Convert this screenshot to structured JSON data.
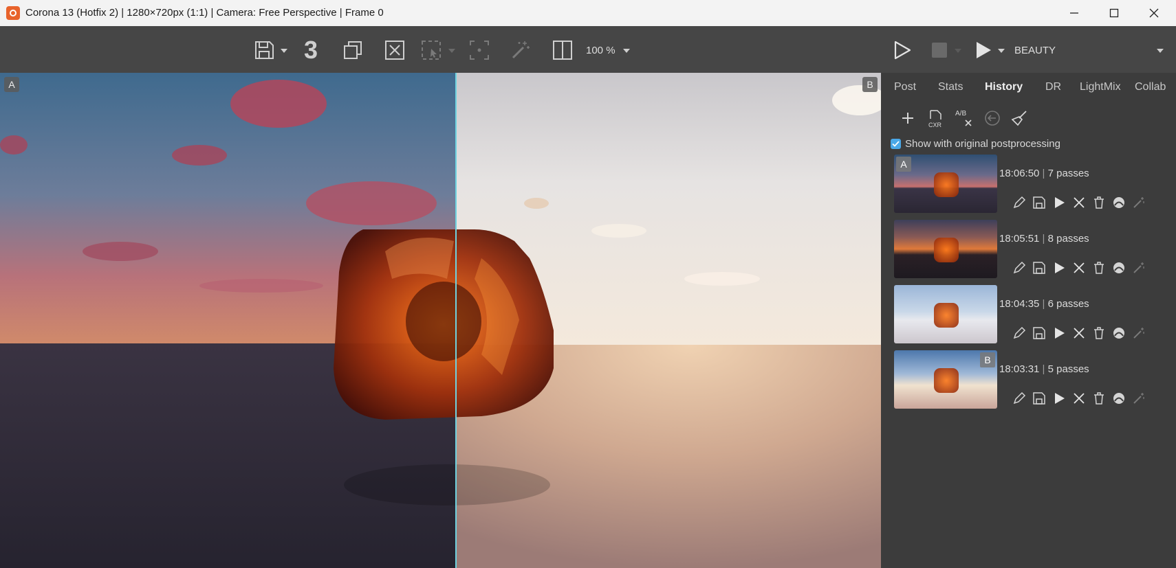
{
  "window": {
    "title": "Corona 13 (Hotfix 2) | 1280×720px (1:1) | Camera: Free Perspective | Frame 0"
  },
  "toolbar": {
    "pass_count": "3",
    "zoom": "100 %",
    "render_element": "BEAUTY"
  },
  "viewport": {
    "label_a": "A",
    "label_b": "B"
  },
  "sidepanel": {
    "tabs": [
      {
        "label": "Post"
      },
      {
        "label": "Stats"
      },
      {
        "label": "History",
        "active": true
      },
      {
        "label": "DR"
      },
      {
        "label": "LightMix"
      },
      {
        "label": "Collab"
      }
    ],
    "toolbar_icons": [
      "plus-icon",
      "save-cxr-icon",
      "ab-clear-icon",
      "revert-icon",
      "broom-icon"
    ],
    "show_original": {
      "label": "Show with original postprocessing",
      "checked": true
    },
    "history": [
      {
        "time": "18:06:50",
        "passes": "7 passes",
        "badge": "A"
      },
      {
        "time": "18:05:51",
        "passes": "8 passes",
        "badge": ""
      },
      {
        "time": "18:04:35",
        "passes": "6 passes",
        "badge": ""
      },
      {
        "time": "18:03:31",
        "passes": "5 passes",
        "badge": "B"
      }
    ]
  },
  "colors": {
    "accent": "#4aa8e8",
    "app_orange": "#e8632b",
    "split_line": "#6fd3e0"
  }
}
